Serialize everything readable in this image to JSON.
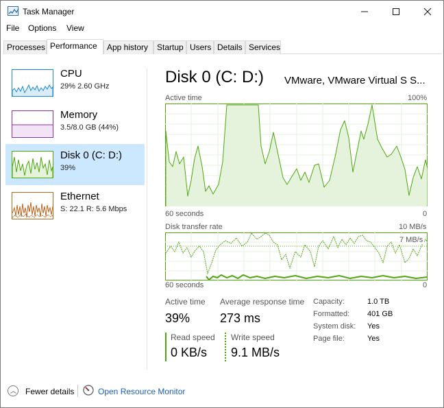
{
  "window": {
    "title": "Task Manager"
  },
  "menu": [
    "File",
    "Options",
    "View"
  ],
  "tabs": [
    "Processes",
    "Performance",
    "App history",
    "Startup",
    "Users",
    "Details",
    "Services"
  ],
  "sidebar": {
    "items": [
      {
        "title": "CPU",
        "subtitle": "29%  2.60 GHz"
      },
      {
        "title": "Memory",
        "subtitle": "3.5/8.0 GB (44%)"
      },
      {
        "title": "Disk 0 (C: D:)",
        "subtitle": "39%"
      },
      {
        "title": "Ethernet",
        "subtitle": "S: 22.1  R: 5.6 Mbps"
      }
    ]
  },
  "disk": {
    "title": "Disk 0 (C: D:)",
    "model": "VMware, VMware Virtual S S...",
    "active_chart": {
      "label": "Active time",
      "max": "100%",
      "time": "60 seconds",
      "zero": "0"
    },
    "transfer_chart": {
      "label": "Disk transfer rate",
      "max": "10 MB/s",
      "marker": "7 MB/s",
      "time": "60 seconds",
      "zero": "0"
    },
    "stats": {
      "active_time_label": "Active time",
      "active_time_value": "39%",
      "avg_resp_label": "Average response time",
      "avg_resp_value": "273 ms",
      "read_label": "Read speed",
      "read_value": "0 KB/s",
      "write_label": "Write speed",
      "write_value": "9.1 MB/s"
    },
    "properties": [
      {
        "key": "Capacity:",
        "value": "1.0 TB"
      },
      {
        "key": "Formatted:",
        "value": "401 GB"
      },
      {
        "key": "System disk:",
        "value": "Yes"
      },
      {
        "key": "Page file:",
        "value": "Yes"
      }
    ]
  },
  "footer": {
    "fewer_details": "Fewer details",
    "open_monitor": "Open Resource Monitor"
  },
  "colors": {
    "disk_green": "#4da60c",
    "cpu_blue": "#1e88d0",
    "memory_purple": "#8b2fa8",
    "ethernet_orange": "#b5651d",
    "selected_bg": "#cce8ff"
  }
}
